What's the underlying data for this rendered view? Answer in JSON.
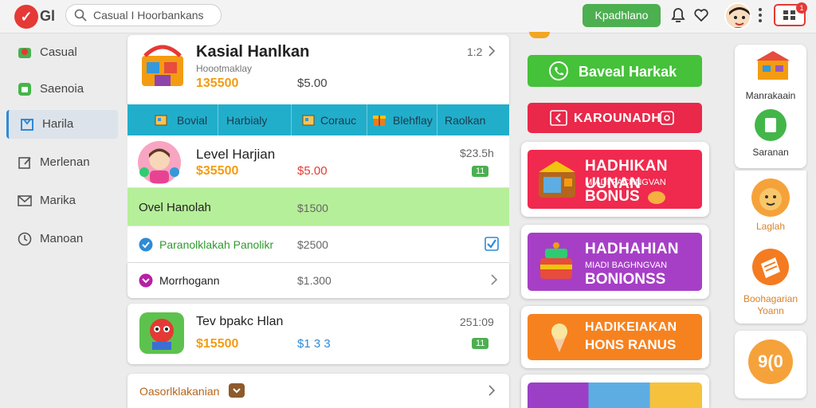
{
  "header": {
    "logo_text": "Gl",
    "search_value": "Casual I Hoorbankans",
    "action_button": "Kpadhlano",
    "mail_badge": "1"
  },
  "sidebar": {
    "items": [
      {
        "label": "Casual",
        "icon": "casual-icon"
      },
      {
        "label": "Saenoia",
        "icon": "saenoia-icon"
      },
      {
        "label": "Harila",
        "icon": "harila-icon",
        "active": true
      },
      {
        "label": "Merlenan",
        "icon": "edit-icon"
      },
      {
        "label": "Marika",
        "icon": "mail-icon"
      },
      {
        "label": "Manoan",
        "icon": "clock-icon"
      }
    ]
  },
  "featured": {
    "title": "Kasial Hanlkan",
    "subtitle": "Hoootmaklay",
    "amount": "135500",
    "price": "$5.00",
    "page": "1:2"
  },
  "tabs": [
    {
      "label": "Bovial",
      "icon": "box-icon"
    },
    {
      "label": "Harbialy",
      "icon": ""
    },
    {
      "label": "Corauc",
      "icon": "box-icon"
    },
    {
      "label": "Blehflay",
      "icon": "gift-icon"
    },
    {
      "label": "Raolkan",
      "icon": ""
    }
  ],
  "rows": [
    {
      "title": "Level Harjian",
      "amount": "$35500",
      "price": "$5.00",
      "right_top": "$23.5h",
      "badge": "11"
    },
    {
      "title": "Ovel Hanolah",
      "price": "$1500"
    },
    {
      "title": "Paranolklakah Panolikr",
      "price": "$2500"
    },
    {
      "title": "Morrhogann",
      "price": "$1.300"
    }
  ],
  "offer": {
    "title": "Tev bpakc Hlan",
    "amount": "$15500",
    "price": "$1 3 3",
    "right_top": "251:09",
    "badge": "11"
  },
  "bottom": {
    "title": "Oasorlklakanian"
  },
  "right": {
    "btn1": "Baveal Harkak",
    "btn2": "KAROUNADH",
    "promo1": {
      "l1": "HADHIKAN UUNAN",
      "l2": "MIADI PACHNGVAN",
      "l3": "BONUS"
    },
    "promo2": {
      "l1": "HADHAHIAN",
      "l2": "MIADI BAGHNGVAN",
      "l3": "BONIONSS"
    },
    "promo3": {
      "l1": "HADIKEIAKAN",
      "l3": "HONS RANUS"
    }
  },
  "far_right": {
    "label1": "Manrakaain",
    "label2": "Saranan",
    "label3": "Laglah",
    "label4a": "Boohagarian",
    "label4b": "Yoann",
    "label5": "9(0"
  },
  "colors": {
    "accent": "#21aecb",
    "green": "#4caf50",
    "red": "#e9284a",
    "purple": "#a63fc6",
    "orange": "#f6821f",
    "highlight": "#b6ef99"
  }
}
